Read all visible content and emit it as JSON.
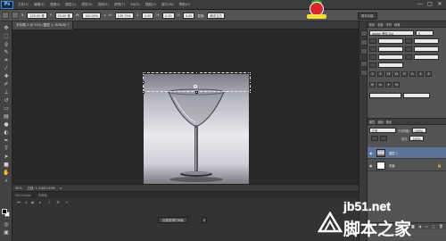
{
  "app": {
    "logo": "Ps",
    "menu": [
      "文件(F)",
      "编辑(E)",
      "图像(I)",
      "图层(L)",
      "类型(Y)",
      "选择(S)",
      "滤镜(T)",
      "3D(D)",
      "视图(V)",
      "窗口(W)",
      "帮助(H)"
    ],
    "window_controls": [
      "—",
      "□",
      "✕"
    ]
  },
  "options": {
    "x_label": "X:",
    "x_value": "225.00 像",
    "y_label": "Y:",
    "y_value": "53.00 像",
    "w_label": "W:",
    "w_value": "100.00%",
    "h_label": "H:",
    "h_value": "139.75%",
    "angle_value": "0.00",
    "h_skew_label": "H:",
    "h_skew_value": "0.00",
    "v_skew_label": "V:",
    "v_skew_value": "0.00",
    "interp_label": "插值:",
    "interp_value": "两次立方",
    "workspace": "基本功能"
  },
  "document": {
    "tab_title": "未标题-1 @ 50% (图层 1, RGB/8) *",
    "zoom": "50%",
    "doc_size": "文档: 1.31M/1.63M"
  },
  "timeline": {
    "tabs": [
      "Mini Bridge",
      "时间轴"
    ],
    "create_button": "创建视频时间轴",
    "dropdown_arrow": "▾"
  },
  "panels": {
    "tabs": [
      "颜色",
      "色板",
      "字符",
      "段落",
      "调整",
      "样式"
    ],
    "font_family": "Adobe 黑体 Std",
    "font_style": "R",
    "layers_tabs": [
      "图层",
      "通道",
      "路径"
    ],
    "blend_mode": "正常",
    "opacity_label": "不透明度:",
    "opacity_value": "100%",
    "fill_label": "填充:",
    "fill_value": "100%",
    "layers": [
      {
        "name": "图层 1",
        "selected": true
      },
      {
        "name": "背景",
        "selected": false
      }
    ]
  },
  "watermark": {
    "url": "jb51.net",
    "site_name": "脚本之家"
  },
  "icons": {
    "tools": [
      "move-icon",
      "marquee-icon",
      "lasso-icon",
      "quick-select-icon",
      "crop-icon",
      "eyedropper-icon",
      "healing-icon",
      "brush-icon",
      "stamp-icon",
      "history-brush-icon",
      "eraser-icon",
      "gradient-icon",
      "blur-icon",
      "dodge-icon",
      "pen-icon",
      "type-icon",
      "path-select-icon",
      "shape-icon",
      "hand-icon",
      "zoom-icon"
    ]
  },
  "colors": {
    "accent": "#5c7497",
    "panel": "#535353",
    "background": "#282828"
  }
}
